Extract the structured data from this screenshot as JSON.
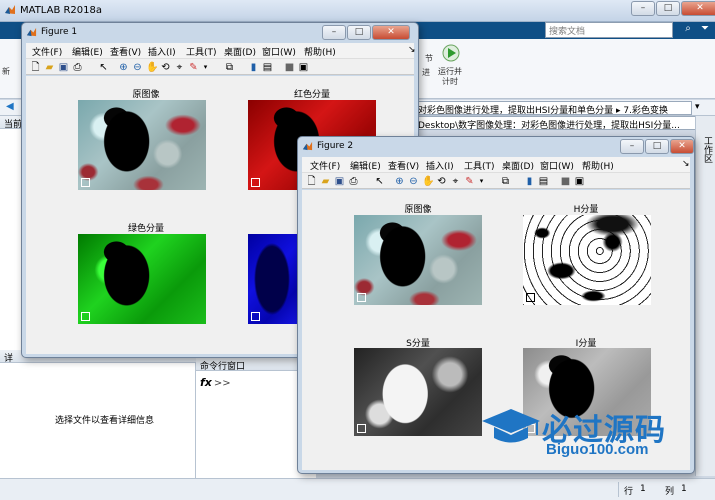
{
  "main_window": {
    "title": "MATLAB R2018a",
    "search_placeholder": "搜索文档",
    "ribbon_run_label_1": "运行并",
    "ribbon_run_label_2": "计时",
    "ribbon_left_label": "新",
    "ribbon_section_label": "节",
    "ribbon_mid_label": "进",
    "current_path": "对彩色图像进行处理，提取出HSI分量和单色分量 ▸ 7.彩色变换",
    "path_line_2": "Desktop\\数字图像处理：对彩色图像进行处理，提取出HSI分量...",
    "left_header_fragment": "当前",
    "detail_header_fragment": "详",
    "detail_message": "选择文件以查看详细信息",
    "command_window_title": "命令行窗口",
    "command_prompt": ">>",
    "workspace_label": "工作区",
    "status_row_label": "行",
    "status_row_value": "1",
    "status_col_label": "列",
    "status_col_value": "1",
    "colors": {
      "ribbon_tab_bar": "#0f4f86",
      "accent_blue": "#1f75c4"
    }
  },
  "figure1": {
    "title": "Figure 1",
    "menu": [
      "文件(F)",
      "编辑(E)",
      "查看(V)",
      "插入(I)",
      "工具(T)",
      "桌面(D)",
      "窗口(W)",
      "帮助(H)"
    ],
    "subplots": [
      "原图像",
      "红色分量",
      "绿色分量"
    ]
  },
  "figure2": {
    "title": "Figure 2",
    "menu": [
      "文件(F)",
      "编辑(E)",
      "查看(V)",
      "插入(I)",
      "工具(T)",
      "桌面(D)",
      "窗口(W)",
      "帮助(H)"
    ],
    "subplots": [
      "原图像",
      "H分量",
      "S分量",
      "I分量"
    ]
  },
  "watermark": {
    "text_cn": "必过源码",
    "text_en": "Biguo100.com"
  }
}
